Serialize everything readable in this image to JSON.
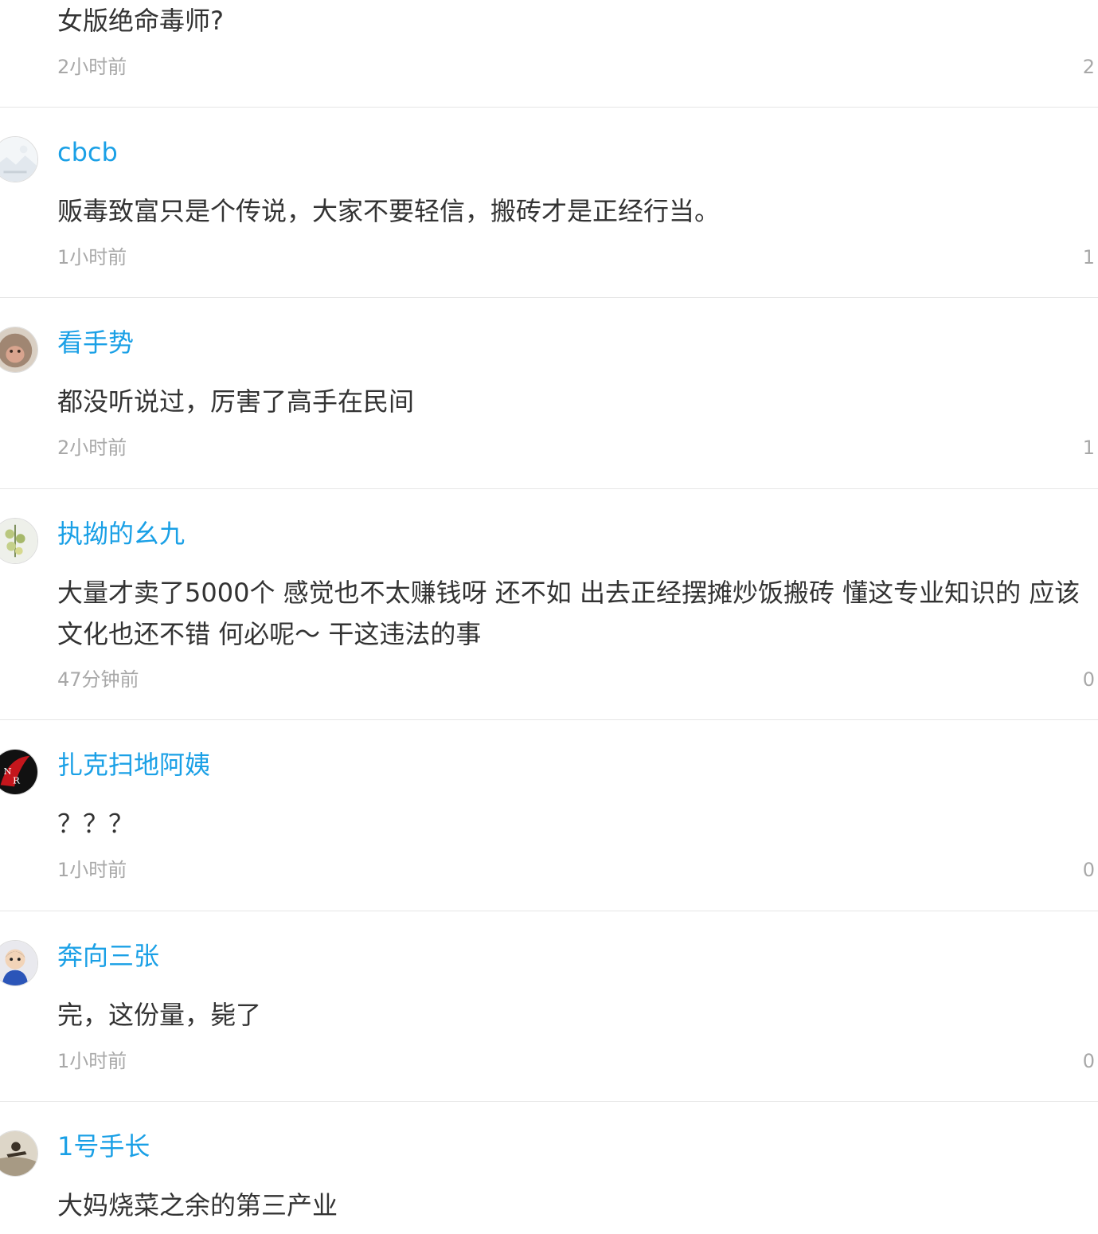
{
  "comments": [
    {
      "username": "",
      "content": "女版绝命毒师?",
      "time": "2小时前",
      "likes": "2"
    },
    {
      "username": "cbcb",
      "avatar_icon": "landscape-avatar-icon",
      "content": "贩毒致富只是个传说，大家不要轻信，搬砖才是正经行当。",
      "time": "1小时前",
      "likes": "1"
    },
    {
      "username": "看手势",
      "avatar_icon": "monkey-avatar-icon",
      "content": "都没听说过，厉害了高手在民间",
      "time": "2小时前",
      "likes": "1"
    },
    {
      "username": "执拗的幺九",
      "avatar_icon": "plant-avatar-icon",
      "content": "大量才卖了5000个 感觉也不太赚钱呀 还不如 出去正经摆摊炒饭搬砖 懂这专业知识的 应该文化也还不错 何必呢～ 干这违法的事",
      "time": "47分钟前",
      "likes": "0"
    },
    {
      "username": "扎克扫地阿姨",
      "avatar_icon": "nerv-logo-avatar-icon",
      "content": "？？？",
      "time": "1小时前",
      "likes": "0"
    },
    {
      "username": "奔向三张",
      "avatar_icon": "cartoon-avatar-icon",
      "content": "完，这份量，毙了",
      "time": "1小时前",
      "likes": "0"
    },
    {
      "username": "1号手长",
      "avatar_icon": "figure-avatar-icon",
      "content": "大妈烧菜之余的第三产业",
      "time": "",
      "likes": ""
    }
  ],
  "colors": {
    "username": "#1aa0e6",
    "content": "#333333",
    "meta": "#a8a8a8",
    "divider": "#e6e6e6"
  }
}
